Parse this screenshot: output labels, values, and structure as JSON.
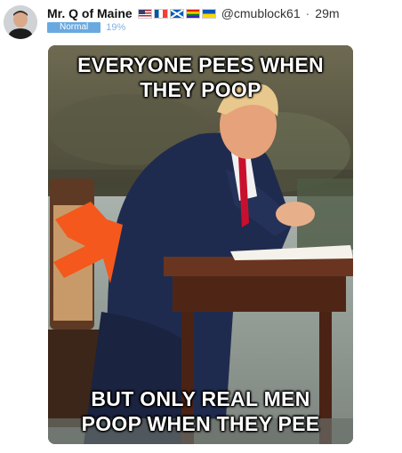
{
  "post": {
    "display_name": "Mr. Q of Maine",
    "handle": "@cmublock61",
    "separator": "·",
    "time_ago": "29m",
    "badge_label": "Normal",
    "badge_percent": "19%",
    "flags": [
      "us-flag",
      "france-flag",
      "scotland-flag",
      "rainbow-flag",
      "ukraine-flag"
    ]
  },
  "meme": {
    "top_text_line1": "EVERYONE PEES WHEN",
    "top_text_line2": "THEY POOP",
    "bottom_text_line1": "BUT ONLY REAL MEN",
    "bottom_text_line2": "POOP WHEN THEY PEE"
  },
  "colors": {
    "arrow": "#f4581c",
    "suit": "#1f2b4e",
    "tie": "#c8102e",
    "table": "#5a2e1c"
  }
}
